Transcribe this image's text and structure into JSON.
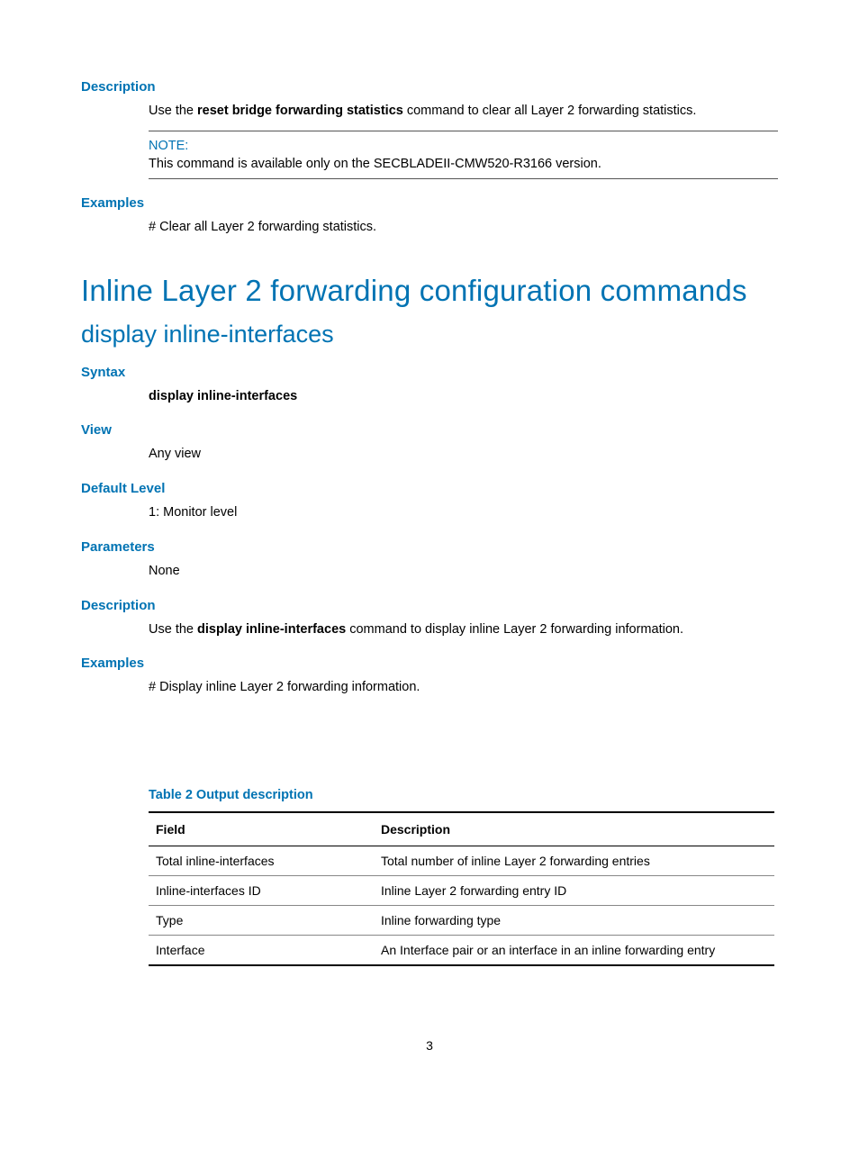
{
  "sections": {
    "desc1": {
      "label": "Description",
      "text_pre": "Use the ",
      "cmd": "reset bridge forwarding statistics",
      "text_post": " command to clear all Layer 2 forwarding statistics."
    },
    "note": {
      "label": "NOTE:",
      "body": "This command is available only on the SECBLADEII-CMW520-R3166 version."
    },
    "examples1": {
      "label": "Examples",
      "text": "# Clear all Layer 2 forwarding statistics."
    }
  },
  "h1": "Inline Layer 2 forwarding configuration commands",
  "h2": "display inline-interfaces",
  "syntax": {
    "label": "Syntax",
    "text": "display inline-interfaces"
  },
  "view": {
    "label": "View",
    "text": "Any view"
  },
  "default_level": {
    "label": "Default Level",
    "text": "1: Monitor level"
  },
  "parameters": {
    "label": "Parameters",
    "text": "None"
  },
  "desc2": {
    "label": "Description",
    "text_pre": "Use the ",
    "cmd": "display inline-interfaces",
    "text_post": " command to display inline Layer 2 forwarding information."
  },
  "examples2": {
    "label": "Examples",
    "text": "# Display inline Layer 2 forwarding information."
  },
  "table": {
    "title": "Table 2 Output description",
    "headers": {
      "field": "Field",
      "desc": "Description"
    },
    "rows": [
      {
        "field": "Total inline-interfaces",
        "desc": "Total number of inline Layer 2 forwarding entries"
      },
      {
        "field": "Inline-interfaces ID",
        "desc": "Inline Layer 2 forwarding entry ID"
      },
      {
        "field": "Type",
        "desc": "Inline forwarding type"
      },
      {
        "field": "Interface",
        "desc": "An Interface pair or an interface in an inline forwarding entry"
      }
    ]
  },
  "page_number": "3"
}
